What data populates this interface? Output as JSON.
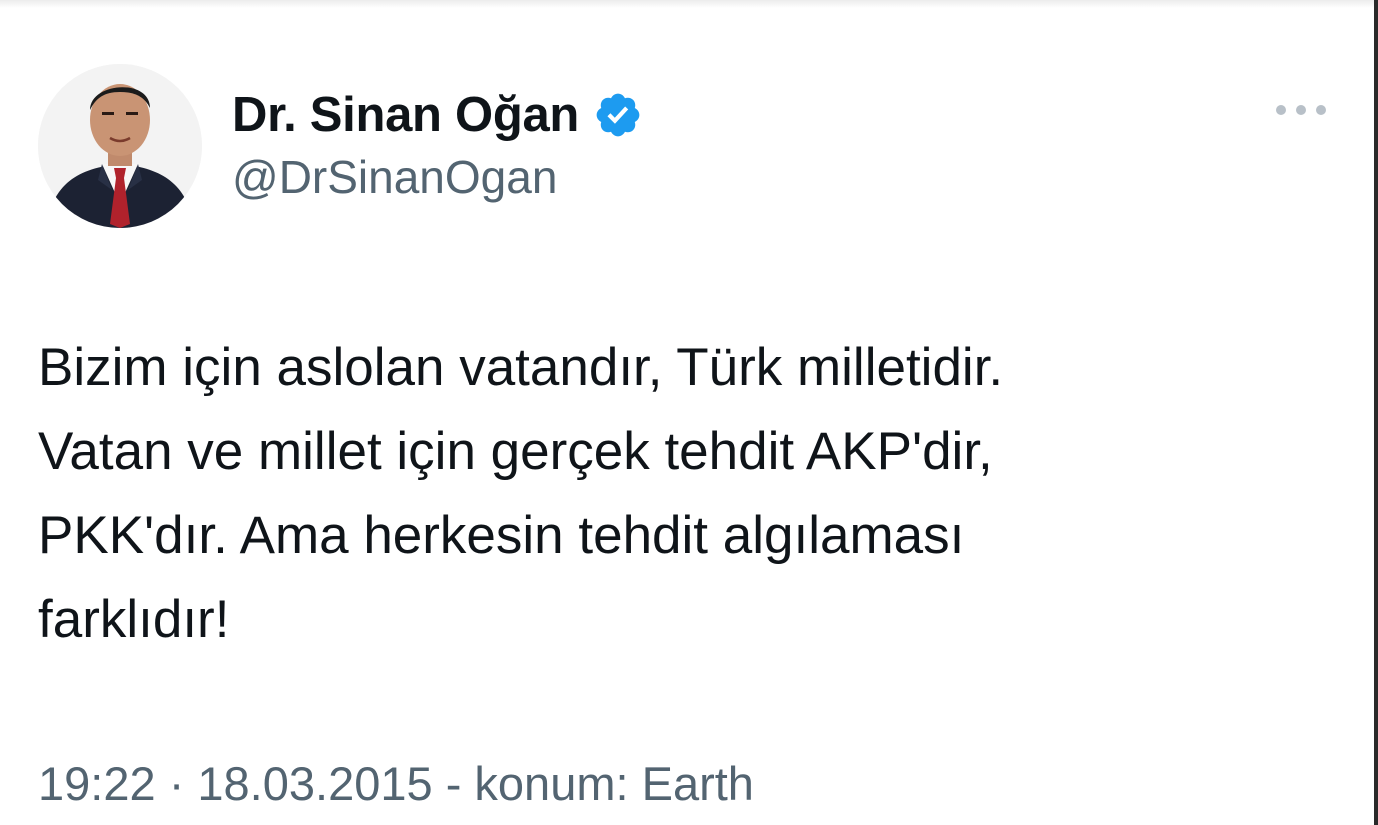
{
  "tweet": {
    "author": {
      "display_name": "Dr. Sinan Oğan",
      "handle": "@DrSinanOgan",
      "verified": true,
      "verified_color": "#1d9bf0"
    },
    "text_lines": [
      "Bizim için aslolan vatandır, Türk milletidir.",
      "Vatan ve millet için gerçek tehdit AKP'dir,",
      "PKK'dır. Ama herkesin tehdit algılaması",
      "farklıdır!"
    ],
    "meta": {
      "time": "19:22",
      "separator": "·",
      "date": "18.03.2015",
      "location": "- konum: Earth"
    },
    "icons": {
      "more": "more-options-icon",
      "verified": "verified-badge-icon"
    }
  }
}
